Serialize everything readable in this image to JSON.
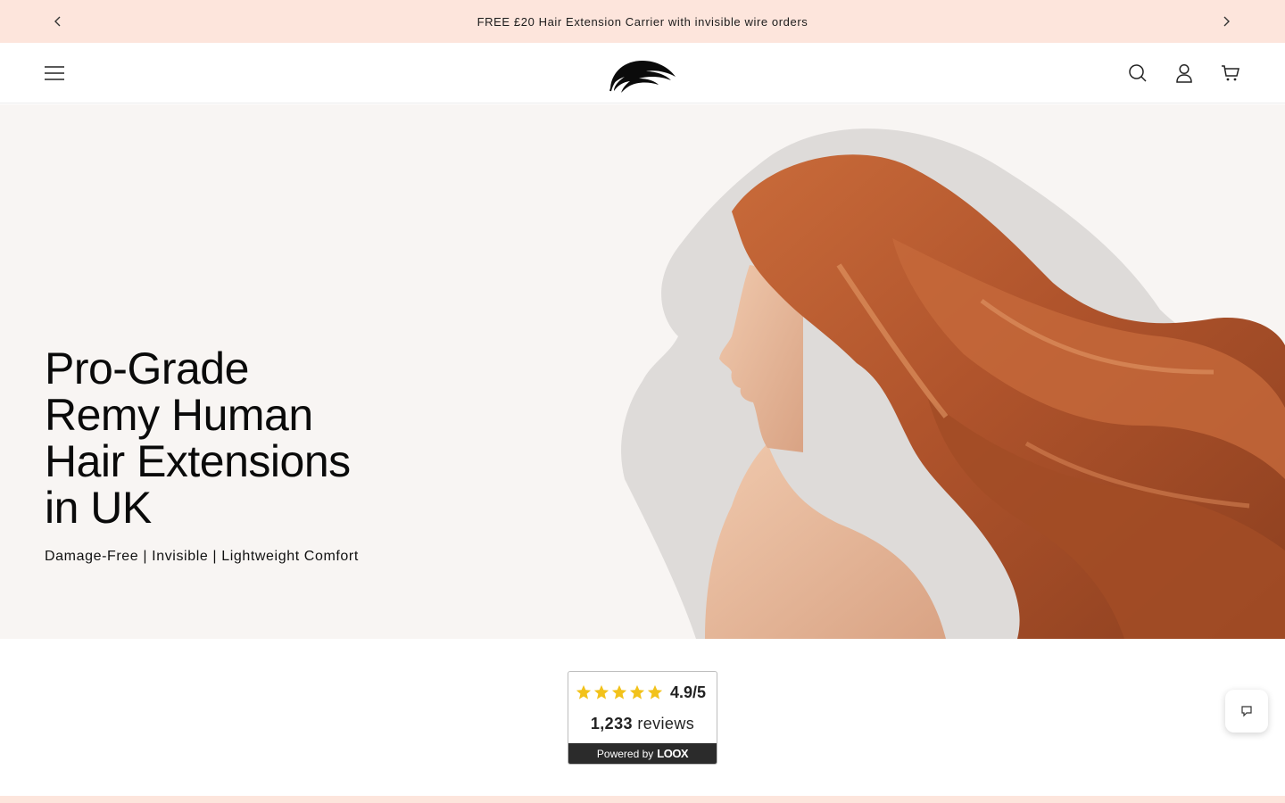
{
  "announcement": {
    "text": "FREE £20 Hair Extension Carrier with invisible wire orders",
    "prev_icon": "chevron-left-icon",
    "next_icon": "chevron-right-icon"
  },
  "header": {
    "menu_icon": "hamburger-menu-icon",
    "logo": "brand-logo-hair-swoosh",
    "icons": [
      "search-icon",
      "account-icon",
      "cart-icon"
    ]
  },
  "hero": {
    "title_lines": [
      "Pro-Grade",
      "Remy Human",
      "Hair Extensions",
      "in UK"
    ],
    "subtitle": "Damage-Free | Invisible | Lightweight Comfort",
    "image": "woman-with-flowing-red-hair-profile"
  },
  "reviews_widget": {
    "rating": "4.9/5",
    "count": "1,233",
    "count_label": "reviews",
    "stars": 5,
    "footer_prefix": "Powered by",
    "footer_brand": "LOOX"
  },
  "chat": {
    "icon": "chat-bubble-icon"
  },
  "colors": {
    "announcement_bg": "#fde5dc",
    "hero_bg": "#f8f5f3",
    "star": "#f2c21b",
    "hair": "#b9592f"
  }
}
